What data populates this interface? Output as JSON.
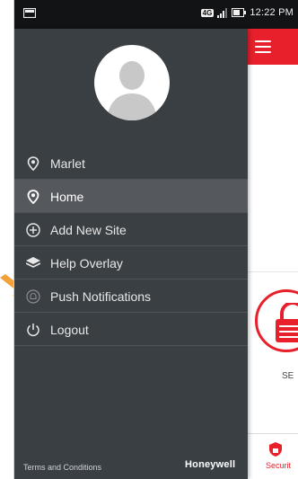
{
  "status_bar": {
    "network": "4G",
    "time": "12:22 PM"
  },
  "drawer": {
    "menu": [
      {
        "label": "Marlet",
        "icon": "location-pin-icon"
      },
      {
        "label": "Home",
        "icon": "location-pin-icon",
        "active": true
      },
      {
        "label": "Add New Site",
        "icon": "plus-circle-icon"
      },
      {
        "label": "Help Overlay",
        "icon": "layers-icon"
      },
      {
        "label": "Push Notifications",
        "icon": "bell-icon"
      },
      {
        "label": "Logout",
        "icon": "power-icon"
      }
    ],
    "footer": {
      "terms": "Terms and Conditions",
      "brand": "Honeywell"
    }
  },
  "background_app": {
    "panel_label": "SE",
    "tab_label": "Securit"
  },
  "colors": {
    "accent_red": "#e8202b",
    "drawer_bg": "#3a3f44",
    "active_item_bg": "#55595e",
    "annotation_arrow": "#f2a23a"
  }
}
